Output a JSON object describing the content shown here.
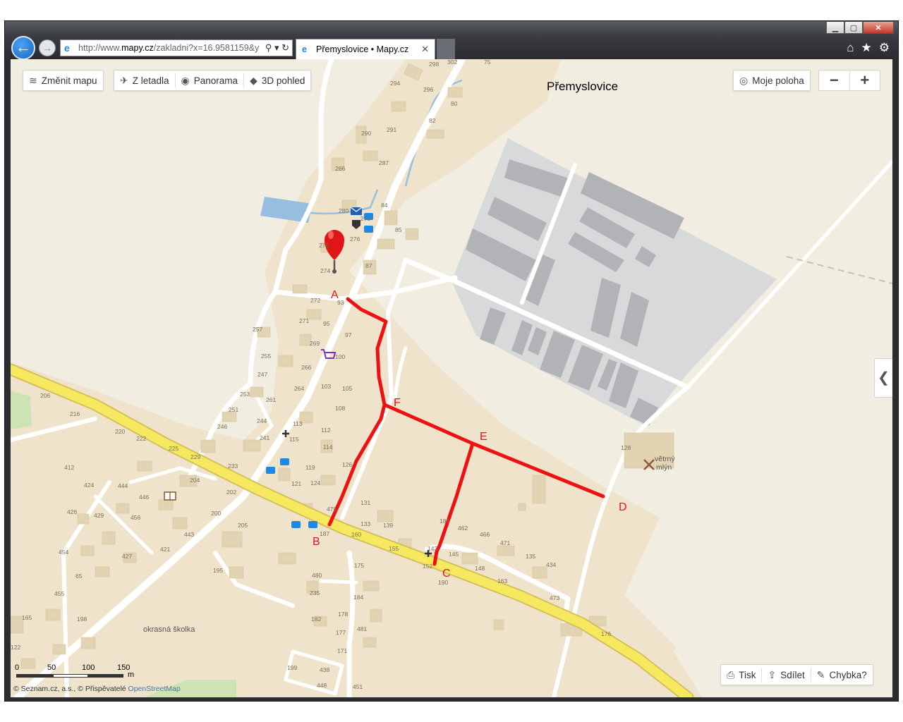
{
  "browser": {
    "address_prefix": "http://www.",
    "address_host": "mapy.cz",
    "address_rest": "/zakladni?x=16.9581159&y",
    "tab_title": "Přemyslovice • Mapy.cz",
    "icons": [
      "back-arrow-icon",
      "forward-arrow-icon",
      "ie-logo-icon",
      "search-icon",
      "refresh-icon",
      "home-icon",
      "star-icon",
      "gear-icon"
    ]
  },
  "toolbar": {
    "change_map": "Změnit mapu",
    "aerial": "Z letadla",
    "panorama": "Panorama",
    "view3d": "3D pohled",
    "my_location": "Moje poloha",
    "zoom_out": "−",
    "zoom_in": "+"
  },
  "map": {
    "title": "Přemyslovice",
    "route_labels": [
      "A",
      "B",
      "C",
      "D",
      "E",
      "F"
    ],
    "poi_windmill_1": "větrný",
    "poi_windmill_2": "mlýn",
    "poi_nursery": "okrasná školka",
    "house_numbers": [
      "298",
      "302",
      "75",
      "294",
      "296",
      "80",
      "82",
      "290",
      "291",
      "287",
      "286",
      "84",
      "278",
      "280",
      "85",
      "276",
      "275",
      "87",
      "274",
      "272",
      "93",
      "271",
      "95",
      "97",
      "257",
      "269",
      "100",
      "255",
      "266",
      "247",
      "264",
      "103",
      "105",
      "253",
      "261",
      "108",
      "251",
      "244",
      "113",
      "246",
      "241",
      "112",
      "115",
      "114",
      "126",
      "206",
      "216",
      "220",
      "222",
      "225",
      "229",
      "233",
      "119",
      "121",
      "124",
      "412",
      "424",
      "444",
      "446",
      "204",
      "202",
      "200",
      "205",
      "187",
      "131",
      "133",
      "139",
      "189",
      "462",
      "466",
      "471",
      "426",
      "429",
      "456",
      "443",
      "160",
      "155",
      "143",
      "145",
      "152",
      "148",
      "135",
      "434",
      "454",
      "427",
      "421",
      "195",
      "480",
      "175",
      "163",
      "190",
      "473",
      "65",
      "455",
      "235",
      "182",
      "184",
      "165",
      "198",
      "481",
      "178",
      "177",
      "171",
      "176",
      "122",
      "199",
      "438",
      "448",
      "451",
      "475",
      "128",
      "150"
    ]
  },
  "scale": {
    "ticks": [
      "0",
      "50",
      "100",
      "150"
    ],
    "unit": "m"
  },
  "copyright": {
    "main": "© Seznam.cz, a.s., © Přispěvatelé ",
    "osm": "OpenStreetMap"
  },
  "bottom": {
    "print": "Tisk",
    "share": "Sdílet",
    "error": "Chybka?"
  },
  "colors": {
    "route": "#ee1111",
    "main_road": "#f6e960",
    "map_background": "#f1ede0",
    "builtup": "#efe4cb",
    "industrial": "#d8d9db"
  }
}
